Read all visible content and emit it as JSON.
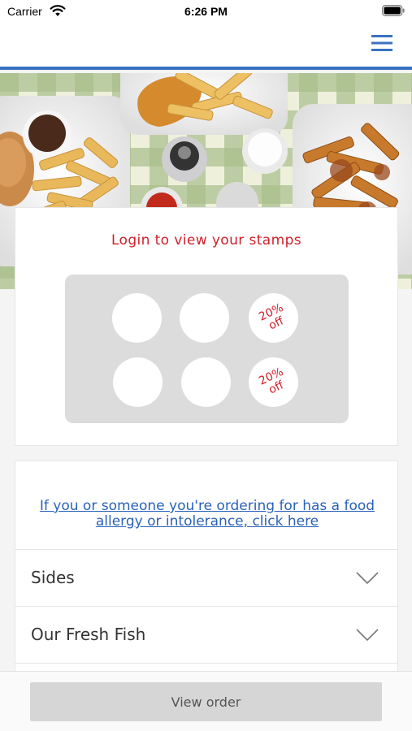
{
  "status_bar": {
    "carrier": "Carrier",
    "time": "6:26 PM"
  },
  "header": {
    "menu_icon": "hamburger-menu-icon",
    "accent_color": "#3b72c0"
  },
  "stamp_card": {
    "title": "Login to view your stamps",
    "title_color": "#d0202a",
    "stamps": [
      {
        "type": "empty"
      },
      {
        "type": "empty"
      },
      {
        "type": "reward",
        "line1": "20%",
        "line2": "off"
      },
      {
        "type": "empty"
      },
      {
        "type": "empty"
      },
      {
        "type": "reward",
        "line1": "20%",
        "line2": "off"
      }
    ]
  },
  "menu": {
    "allergy_link": "If you or someone you're ordering for has a food allergy or intolerance, click here",
    "categories": [
      {
        "label": "Sides"
      },
      {
        "label": "Our Fresh Fish"
      }
    ]
  },
  "footer": {
    "view_order_label": "View order"
  }
}
